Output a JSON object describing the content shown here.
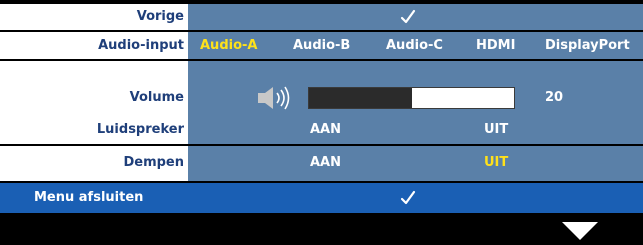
{
  "menu": {
    "rows": [
      {
        "label": "Vorige",
        "check": true
      },
      {
        "label": "Audio-input",
        "options": [
          "Audio-A",
          "Audio-B",
          "Audio-C",
          "HDMI",
          "DisplayPort"
        ],
        "selected": 0
      },
      {
        "label": "Volume",
        "value": "20",
        "level": 0.5
      },
      {
        "label": "Luidspreker",
        "options": [
          "AAN",
          "UIT"
        ],
        "selected": null
      },
      {
        "label": "Dempen",
        "options": [
          "AAN",
          "UIT"
        ],
        "selected": 1
      }
    ],
    "exit_label": "Menu afsluiten"
  },
  "icons": {
    "check": "checkmark-icon",
    "volume": "speaker-icon",
    "next": "down-triangle-icon"
  },
  "colors": {
    "row_bg": "#5a80a8",
    "label_text": "#1f3f7a",
    "selected_text": "#ffe11a",
    "exit_bar": "#1a5fb4"
  }
}
